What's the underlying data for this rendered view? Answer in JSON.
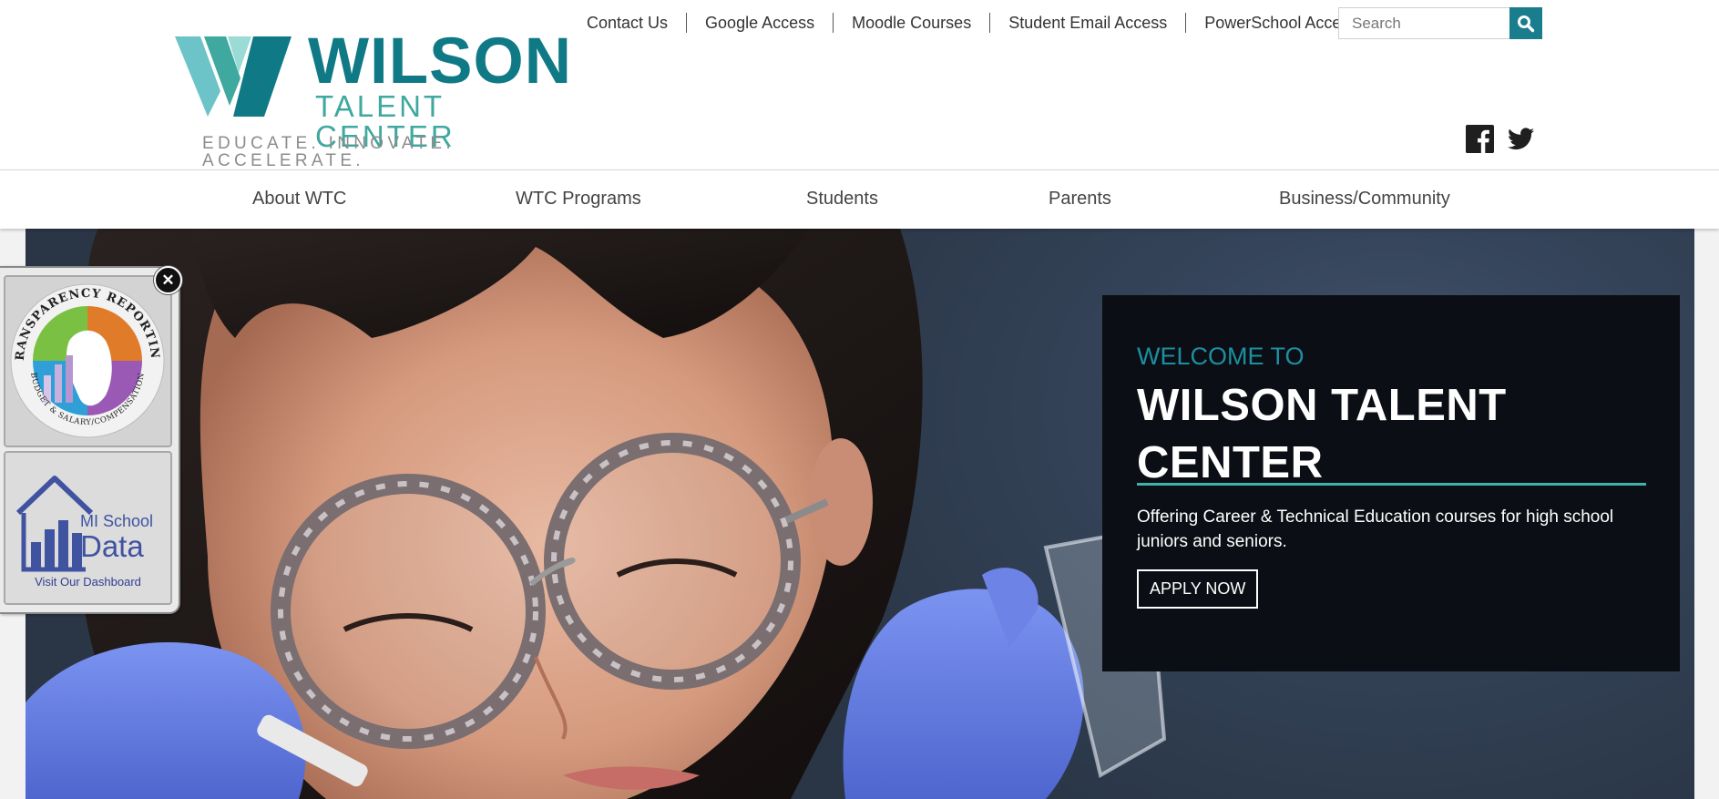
{
  "brand": {
    "name": "WILSON",
    "subtitle": "TALENT CENTER",
    "tagline": "EDUCATE. INNOVATE. ACCELERATE.",
    "colors": {
      "primary": "#0f7a85",
      "secondary": "#3fa89f",
      "accent": "#1a7d8e"
    }
  },
  "utility_links": [
    "Contact Us",
    "Google Access",
    "Moodle Courses",
    "Student Email Access",
    "PowerSchool Access"
  ],
  "search": {
    "placeholder": "Search",
    "icon": "magnifier-icon"
  },
  "social": [
    "facebook-icon",
    "twitter-icon"
  ],
  "nav": [
    "About WTC",
    "WTC Programs",
    "Students",
    "Parents",
    "Business/Community"
  ],
  "hero": {
    "welcome_pre": "WELCOME TO",
    "welcome_title": "WILSON TALENT CENTER",
    "description": "Offering Career & Technical Education courses for high school juniors and seniors.",
    "cta": "APPLY NOW"
  },
  "side_widget": {
    "close_icon": "close-icon",
    "transparency": {
      "arc_top": "TRANSPARENCY REPORTING",
      "arc_bottom": "BUDGET & SALARY/COMPENSATION"
    },
    "mi_school": {
      "line1": "MI School",
      "line2": "Data",
      "link": "Visit Our Dashboard"
    }
  }
}
